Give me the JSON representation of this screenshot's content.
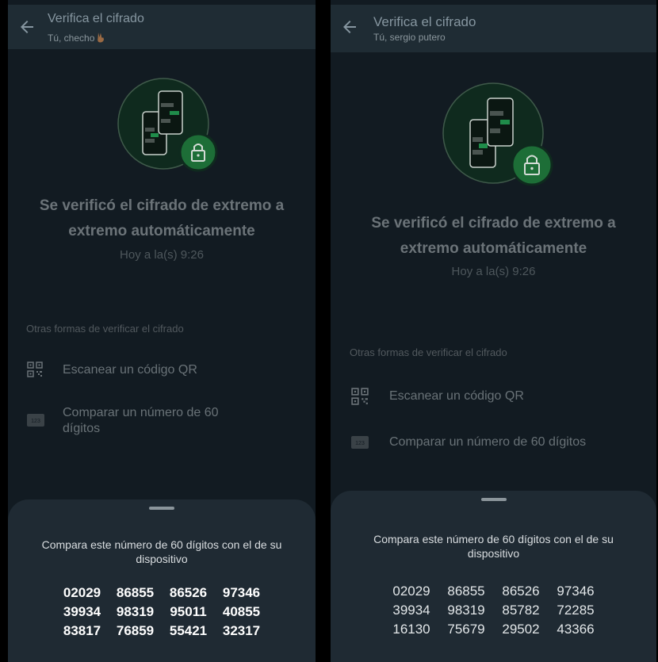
{
  "left": {
    "title": "Verifica el cifrado",
    "subtitle": "Tú, checho",
    "subtitle_emoji": "victory-hand-emoji",
    "headline_line1": "Se verificó el cifrado de extremo a",
    "headline_line2": "extremo automáticamente",
    "time": "Hoy a la(s) 9:26",
    "section": "Otras formas de verificar el cifrado",
    "scan_label": "Escanear un código QR",
    "compare_label": "Comparar un número de 60 dígitos",
    "number_badge": "123",
    "sheet_text": "Compara este número de 60 dígitos con el de su dispositivo",
    "codes": [
      [
        "02029",
        "86855",
        "86526",
        "97346"
      ],
      [
        "39934",
        "98319",
        "95011",
        "40855"
      ],
      [
        "83817",
        "76859",
        "55421",
        "32317"
      ]
    ]
  },
  "right": {
    "title": "Verifica el cifrado",
    "subtitle": "Tú, sergio putero",
    "headline_line1": "Se verificó el cifrado de extremo a",
    "headline_line2": "extremo automáticamente",
    "time": "Hoy a la(s) 9:26",
    "section": "Otras formas de verificar el cifrado",
    "scan_label": "Escanear un código QR",
    "compare_label": "Comparar un número de 60 dígitos",
    "number_badge": "123",
    "sheet_text": "Compara este número de 60 dígitos con el de su dispositivo",
    "codes": [
      [
        "02029",
        "86855",
        "86526",
        "97346"
      ],
      [
        "39934",
        "98319",
        "85782",
        "72285"
      ],
      [
        "16130",
        "75679",
        "29502",
        "43366"
      ]
    ]
  },
  "colors": {
    "background": "#121b22",
    "topbar": "#1f2c34",
    "accent_green": "#1d7a3c",
    "sheet": "#1f2a33"
  }
}
